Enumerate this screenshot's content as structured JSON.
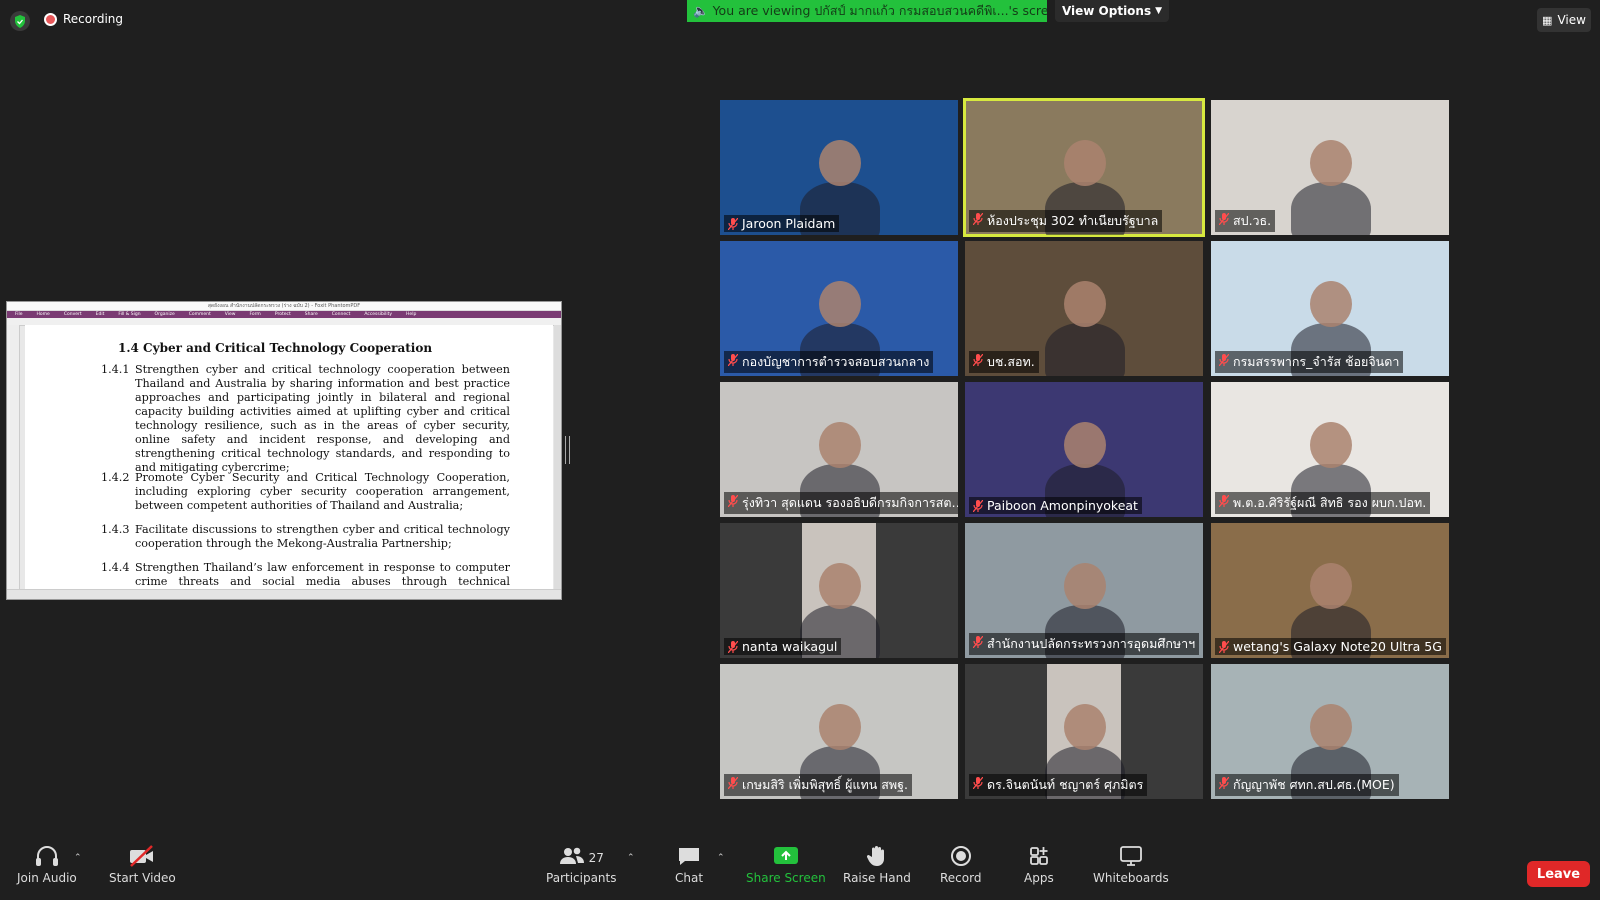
{
  "top": {
    "recording_label": "Recording",
    "viewing_text": "You are viewing ปกัสป์ มากแก้ว กรมสอบสวนคดีพิเ...'s screen",
    "view_options_label": "View Options",
    "view_label": "View"
  },
  "shared_doc": {
    "window_title": "สุดยังงอน สำนักงานปลัดกระทรวง (ร่าง ฉบับ 2) - Foxit PhantomPDF",
    "ribbon": [
      "File",
      "Home",
      "Convert",
      "Edit",
      "Fill & Sign",
      "Organize",
      "Comment",
      "View",
      "Form",
      "Protect",
      "Share",
      "Connect",
      "Accessibility",
      "Help"
    ],
    "heading": "1.4 Cyber and Critical Technology Cooperation",
    "items": [
      {
        "num": "1.4.1",
        "text": "Strengthen cyber and critical technology cooperation between Thailand and Australia by sharing information and best practice approaches and participating jointly in bilateral and regional capacity building activities aimed at uplifting cyber and critical technology resilience, such as in the areas of cyber security, online safety and incident response, and developing and strengthening critical technology standards, and responding to and mitigating cybercrime;"
      },
      {
        "num": "1.4.2",
        "text": "Promote Cyber Security and Critical Technology Cooperation, including exploring cyber security cooperation arrangement, between competent authorities of Thailand and Australia;"
      },
      {
        "num": "1.4.3",
        "text": "Facilitate discussions to strengthen cyber and critical technology cooperation through the Mekong-Australia Partnership;"
      },
      {
        "num": "1.4.4",
        "text": "Strengthen Thailand’s law enforcement in response to computer crime threats and social media abuses through technical assistance"
      }
    ]
  },
  "participants_tiles": [
    {
      "name": "Jaroon Plaidam",
      "bg": "#1d4f8f"
    },
    {
      "name": "ห้องประชุม 302 ทำเนียบรัฐบาล",
      "bg": "#8a7a5e"
    },
    {
      "name": "สป.วธ.",
      "bg": "#d8d4cf"
    },
    {
      "name": "กองบัญชาการตำรวจสอบสวนกลาง",
      "bg": "#2b5aa8"
    },
    {
      "name": "บช.สอท.",
      "bg": "#5e4d3b"
    },
    {
      "name": "กรมสรรพากร_จำรัส ช้อยจินดา",
      "bg": "#c9dbe8"
    },
    {
      "name": "รุ่งทิวา สุดแดน รองอธิบดีกรมกิจการสตรีและสถาบันครอบครัว",
      "bg": "#c7c5c2"
    },
    {
      "name": "Paiboon Amonpinyokeat",
      "bg": "#3c3872"
    },
    {
      "name": "พ.ต.อ.ศิริรัฐ์ผณี สิทธิ รอง ผบก.ปอท.",
      "bg": "#e9e6e2"
    },
    {
      "name": "nanta waikagul",
      "bg": "#3a3a3a"
    },
    {
      "name": "สำนักงานปลัดกระทรวงการอุดมศึกษาฯ",
      "bg": "#8f9aa1"
    },
    {
      "name": "wetang's Galaxy Note20 Ultra 5G",
      "bg": "#8a6d4a"
    },
    {
      "name": "เกษมสิริ เพิ่มพิสุทธิ์ ผู้แทน สพฐ.",
      "bg": "#c6c6c3"
    },
    {
      "name": "ดร.จินตนันท์ ชญาตร์ ศุภมิตร",
      "bg": "#3a3a3a"
    },
    {
      "name": "กัญญาพัช ศทก.สป.ศธ.(MOE)",
      "bg": "#a7b3b6"
    }
  ],
  "toolbar": {
    "join_audio": "Join Audio",
    "start_video": "Start Video",
    "participants": "Participants",
    "participants_count": "27",
    "chat": "Chat",
    "share_screen": "Share Screen",
    "raise_hand": "Raise Hand",
    "record": "Record",
    "apps": "Apps",
    "whiteboards": "Whiteboards",
    "leave": "Leave"
  }
}
